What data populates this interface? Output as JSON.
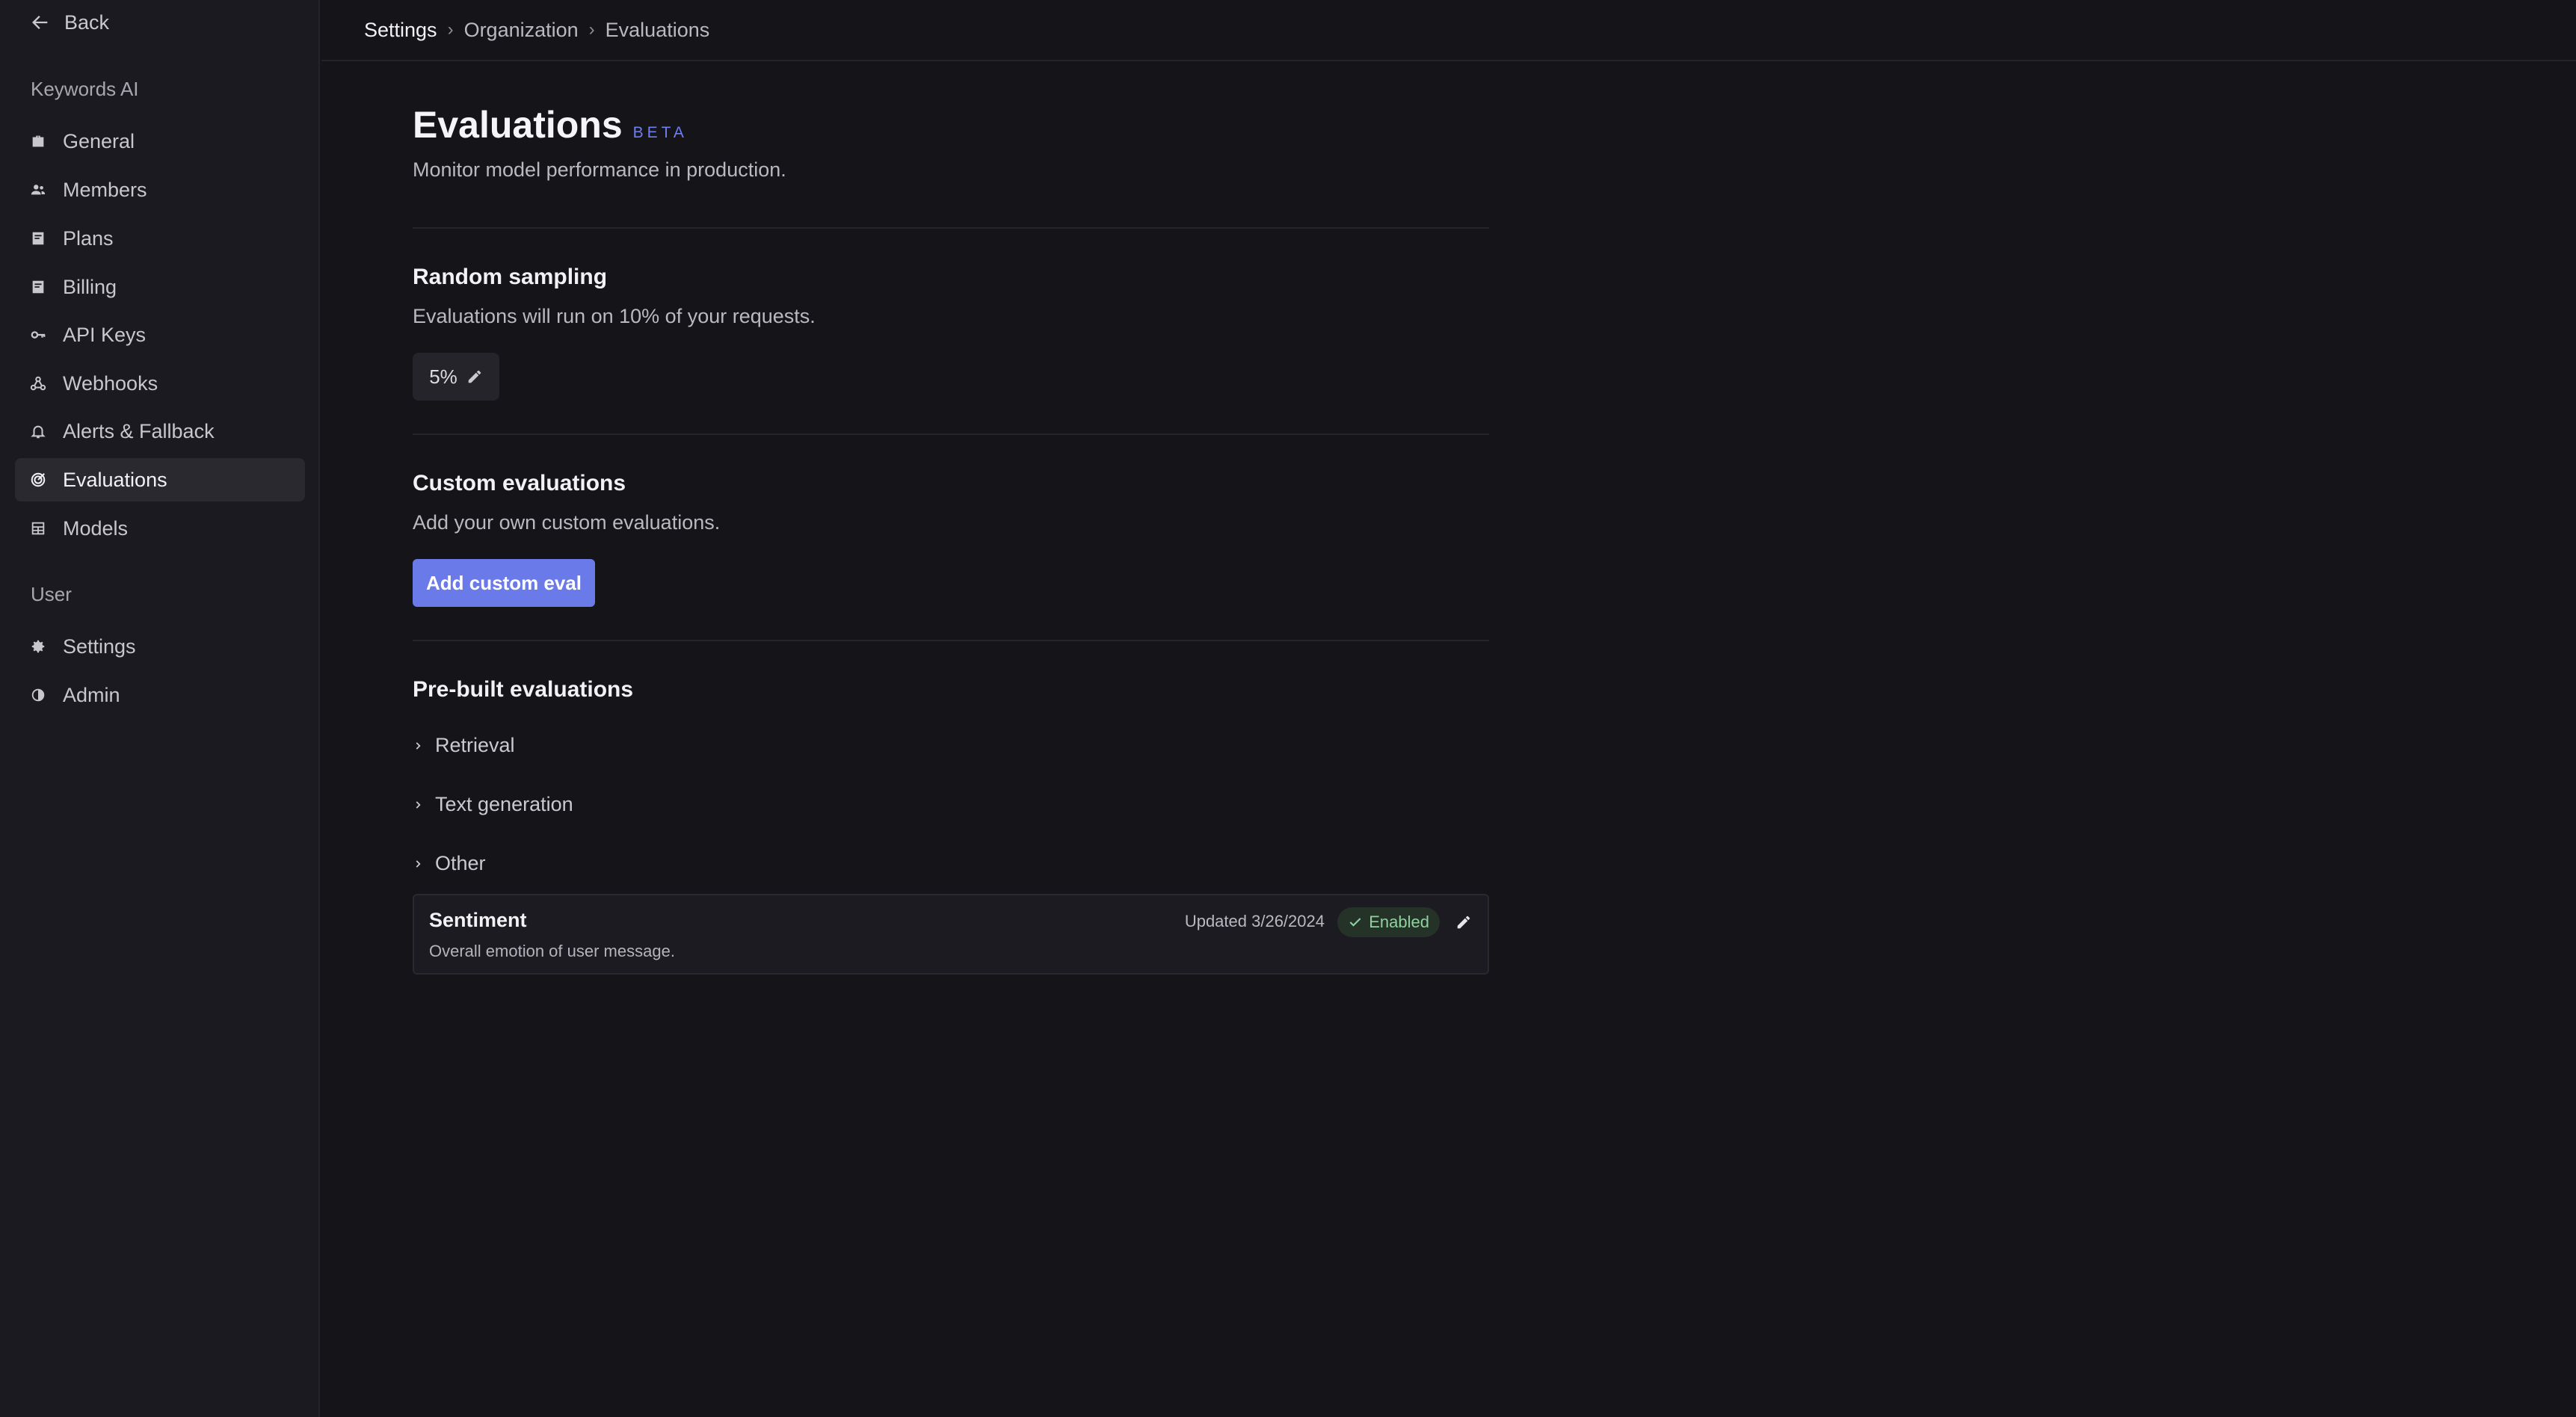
{
  "sidebar": {
    "back_label": "Back",
    "org_section": "Keywords AI",
    "org_items": [
      {
        "label": "General",
        "icon": "briefcase-icon"
      },
      {
        "label": "Members",
        "icon": "people-icon"
      },
      {
        "label": "Plans",
        "icon": "receipt-icon"
      },
      {
        "label": "Billing",
        "icon": "receipt-icon"
      },
      {
        "label": "API Keys",
        "icon": "key-icon"
      },
      {
        "label": "Webhooks",
        "icon": "webhook-icon"
      },
      {
        "label": "Alerts & Fallback",
        "icon": "bell-icon"
      },
      {
        "label": "Evaluations",
        "icon": "target-icon",
        "active": true
      },
      {
        "label": "Models",
        "icon": "table-icon"
      }
    ],
    "user_section": "User",
    "user_items": [
      {
        "label": "Settings",
        "icon": "gear-icon"
      },
      {
        "label": "Admin",
        "icon": "half-circle-icon"
      }
    ]
  },
  "breadcrumb": [
    "Settings",
    "Organization",
    "Evaluations"
  ],
  "page": {
    "title": "Evaluations",
    "badge": "BETA",
    "subtitle": "Monitor model performance in production."
  },
  "random_sampling": {
    "title": "Random sampling",
    "description": "Evaluations will run on 10% of your requests.",
    "value": "5%"
  },
  "custom_evaluations": {
    "title": "Custom evaluations",
    "description": "Add your own custom evaluations.",
    "button_label": "Add custom eval"
  },
  "prebuilt": {
    "title": "Pre-built evaluations",
    "groups": [
      "Retrieval",
      "Text generation",
      "Other"
    ],
    "card": {
      "name": "Sentiment",
      "description": "Overall emotion of user message.",
      "updated": "Updated 3/26/2024",
      "status": "Enabled"
    }
  },
  "colors": {
    "accent": "#6a7ae8",
    "beta": "#6f7ff0",
    "enabled_text": "#8fd29e",
    "background": "#151419"
  }
}
